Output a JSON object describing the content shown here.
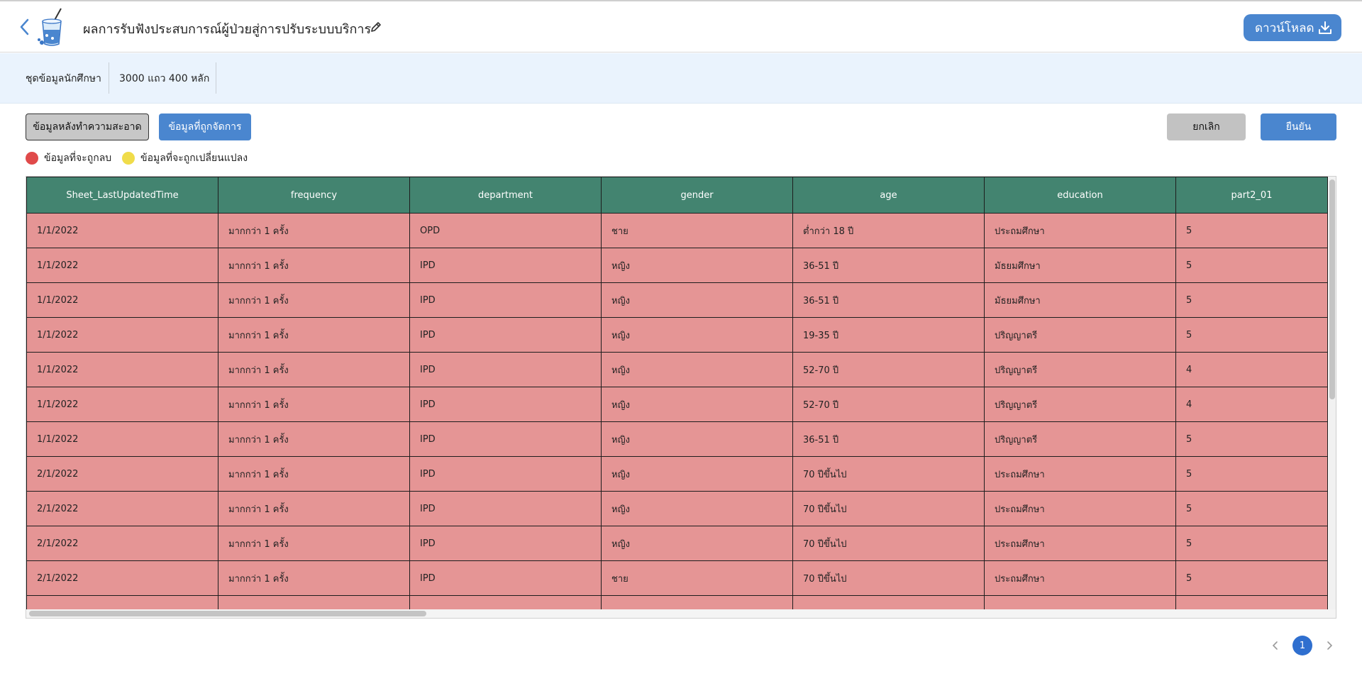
{
  "header": {
    "title": "ผลการรับฟังประสบการณ์ผู้ป่วยสู่การปรับระบบบริการ",
    "download_label": "ดาวน์โหลด"
  },
  "info": {
    "dataset_name": "ชุดข้อมูลนักศึกษา",
    "dimensions": "3000 แถว 400 หลัก"
  },
  "tabs": {
    "cleaned_label": "ข้อมูลหลังทำความสะอาด",
    "managed_label": "ข้อมูลที่ถูกจัดการ"
  },
  "actions": {
    "cancel_label": "ยกเลิก",
    "confirm_label": "ยืนยัน"
  },
  "legend": {
    "delete_label": "ข้อมูลที่จะถูกลบ",
    "delete_color": "#e04a4a",
    "change_label": "ข้อมูลที่จะถูกเปลี่ยนแปลง",
    "change_color": "#f0dc4a"
  },
  "table": {
    "columns": [
      "Sheet_LastUpdatedTime",
      "frequency",
      "department",
      "gender",
      "age",
      "education",
      "part2_01"
    ],
    "rows": [
      [
        "1/1/2022",
        "มากกว่า 1 ครั้ง",
        "OPD",
        "ชาย",
        "ต่ำกว่า 18 ปี",
        "ประถมศึกษา",
        "5"
      ],
      [
        "1/1/2022",
        "มากกว่า 1 ครั้ง",
        "IPD",
        "หญิง",
        "36-51 ปี",
        "มัธยมศึกษา",
        "5"
      ],
      [
        "1/1/2022",
        "มากกว่า 1 ครั้ง",
        "IPD",
        "หญิง",
        "36-51 ปี",
        "มัธยมศึกษา",
        "5"
      ],
      [
        "1/1/2022",
        "มากกว่า 1 ครั้ง",
        "IPD",
        "หญิง",
        "19-35 ปี",
        "ปริญญาตรี",
        "5"
      ],
      [
        "1/1/2022",
        "มากกว่า 1 ครั้ง",
        "IPD",
        "หญิง",
        "52-70 ปี",
        "ปริญญาตรี",
        "4"
      ],
      [
        "1/1/2022",
        "มากกว่า 1 ครั้ง",
        "IPD",
        "หญิง",
        "52-70 ปี",
        "ปริญญาตรี",
        "4"
      ],
      [
        "1/1/2022",
        "มากกว่า 1 ครั้ง",
        "IPD",
        "หญิง",
        "36-51 ปี",
        "ปริญญาตรี",
        "5"
      ],
      [
        "2/1/2022",
        "มากกว่า 1 ครั้ง",
        "IPD",
        "หญิง",
        "70 ปีขึ้นไป",
        "ประถมศึกษา",
        "5"
      ],
      [
        "2/1/2022",
        "มากกว่า 1 ครั้ง",
        "IPD",
        "หญิง",
        "70 ปีขึ้นไป",
        "ประถมศึกษา",
        "5"
      ],
      [
        "2/1/2022",
        "มากกว่า 1 ครั้ง",
        "IPD",
        "หญิง",
        "70 ปีขึ้นไป",
        "ประถมศึกษา",
        "5"
      ],
      [
        "2/1/2022",
        "มากกว่า 1 ครั้ง",
        "IPD",
        "ชาย",
        "70 ปีขึ้นไป",
        "ประถมศึกษา",
        "5"
      ],
      [
        "",
        "",
        "",
        "",
        "",
        "",
        ""
      ]
    ],
    "row_color": "#e59595",
    "header_color": "#438470"
  },
  "pagination": {
    "current_page": "1"
  }
}
